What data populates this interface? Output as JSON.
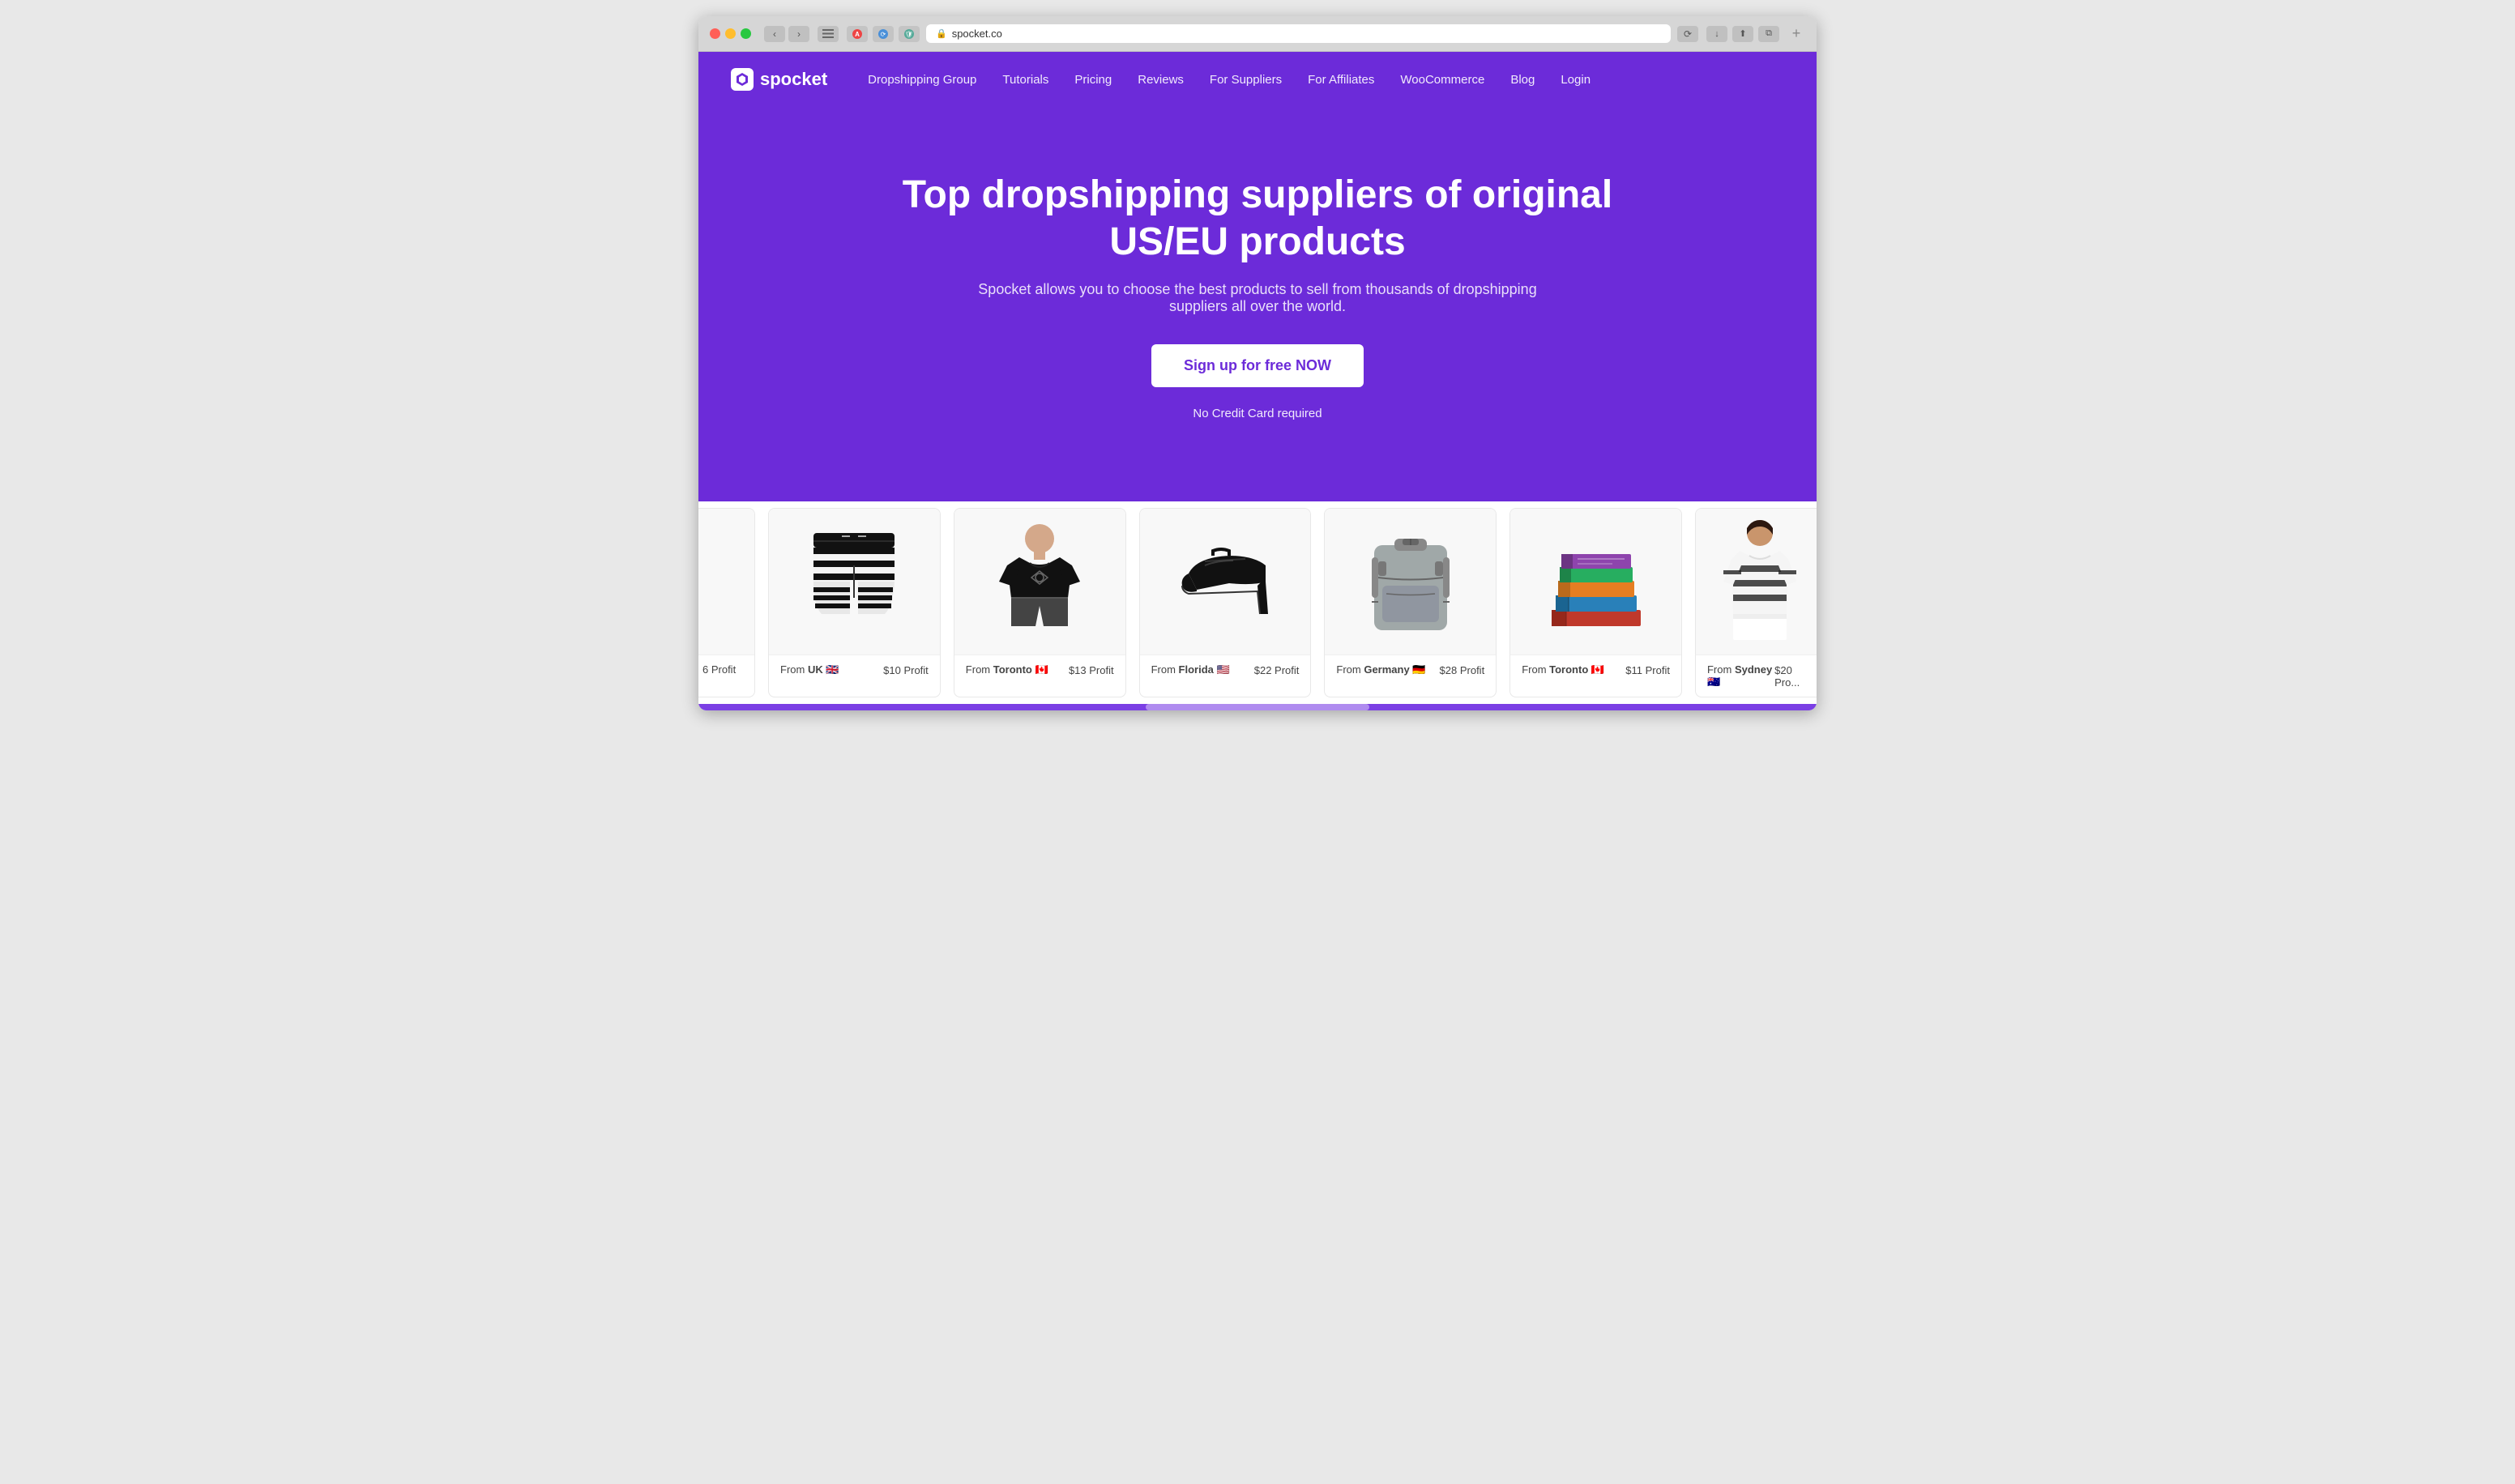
{
  "browser": {
    "url": "spocket.co",
    "new_tab_label": "+"
  },
  "nav": {
    "logo_text": "spocket",
    "links": [
      {
        "label": "Dropshipping Group",
        "id": "dropshipping-group"
      },
      {
        "label": "Tutorials",
        "id": "tutorials"
      },
      {
        "label": "Pricing",
        "id": "pricing"
      },
      {
        "label": "Reviews",
        "id": "reviews"
      },
      {
        "label": "For Suppliers",
        "id": "for-suppliers"
      },
      {
        "label": "For Affiliates",
        "id": "for-affiliates"
      },
      {
        "label": "WooCommerce",
        "id": "woocommerce"
      },
      {
        "label": "Blog",
        "id": "blog"
      },
      {
        "label": "Login",
        "id": "login"
      }
    ]
  },
  "hero": {
    "title": "Top dropshipping suppliers of original US/EU products",
    "subtitle": "Spocket allows you to choose the best products to sell from thousands of dropshipping suppliers all over the world.",
    "cta_label": "Sign up for free NOW",
    "no_cc_text": "No Credit Card required"
  },
  "products": [
    {
      "id": "partial-left",
      "from_location": "",
      "flag": "",
      "profit": "6 Profit",
      "type": "partial"
    },
    {
      "id": "shorts",
      "from_location": "UK",
      "flag": "🇬🇧",
      "profit": "$10 Profit",
      "type": "shorts"
    },
    {
      "id": "tshirt",
      "from_location": "Toronto",
      "flag": "🇨🇦",
      "profit": "$13 Profit",
      "type": "tshirt"
    },
    {
      "id": "heels",
      "from_location": "Florida",
      "flag": "🇺🇸",
      "profit": "$22 Profit",
      "type": "heels"
    },
    {
      "id": "backpack",
      "from_location": "Germany",
      "flag": "🇩🇪",
      "profit": "$28 Profit",
      "type": "backpack"
    },
    {
      "id": "books",
      "from_location": "Toronto",
      "flag": "🇨🇦",
      "profit": "$11 Profit",
      "type": "books"
    },
    {
      "id": "cardigan",
      "from_location": "Sydney",
      "flag": "🇦🇺",
      "profit": "$20 Pro...",
      "type": "cardigan"
    }
  ],
  "colors": {
    "brand_purple": "#6c2bd9",
    "nav_bg": "#6c2bd9"
  }
}
